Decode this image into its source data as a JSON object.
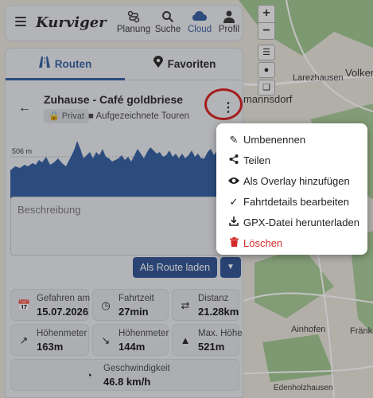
{
  "app": {
    "logo": "Kurviger"
  },
  "nav": {
    "items": [
      {
        "label": "Planung",
        "icon": "route-icon"
      },
      {
        "label": "Suche",
        "icon": "search-icon"
      },
      {
        "label": "Cloud",
        "icon": "cloud-icon",
        "active": true
      },
      {
        "label": "Profil",
        "icon": "person-icon"
      }
    ]
  },
  "tabs": [
    {
      "label": "Routen",
      "icon": "road-icon",
      "active": true
    },
    {
      "label": "Favoriten",
      "icon": "pin-icon"
    }
  ],
  "route": {
    "title": "Zuhause - Café goldbriese",
    "privacy": "Privat",
    "folder": "Aufgezeichnete Touren"
  },
  "chart_data": {
    "type": "area",
    "title": "",
    "ylabel": "",
    "gridline_label": "506 m",
    "note": "elevation profile"
  },
  "description": {
    "placeholder": "Beschreibung"
  },
  "actions": {
    "load_route": "Als Route laden"
  },
  "stats": [
    {
      "label": "Gefahren am",
      "value": "15.07.2026",
      "icon": "calendar-icon"
    },
    {
      "label": "Fahrtzeit",
      "value": "27min",
      "icon": "clock-icon"
    },
    {
      "label": "Distanz",
      "value": "21.28km",
      "icon": "arrows-icon"
    },
    {
      "label": "Höhenmeter",
      "value": "163m",
      "icon": "up-arrow-icon"
    },
    {
      "label": "Höhenmeter",
      "value": "144m",
      "icon": "down-arrow-icon"
    },
    {
      "label": "Max. Höhe",
      "value": "521m",
      "icon": "mountain-icon"
    },
    {
      "label": "Geschwindigkeit",
      "value": "46.8 km/h",
      "icon": "speedometer-icon"
    }
  ],
  "menu": [
    {
      "label": "Umbenennen",
      "icon": "pencil-icon"
    },
    {
      "label": "Teilen",
      "icon": "share-icon"
    },
    {
      "label": "Als Overlay hinzufügen",
      "icon": "eye-icon"
    },
    {
      "label": "Fahrtdetails bearbeiten",
      "icon": "check-icon"
    },
    {
      "label": "GPX-Datei herunterladen",
      "icon": "download-icon"
    },
    {
      "label": "Löschen",
      "icon": "trash-icon",
      "danger": true
    }
  ],
  "map": {
    "places": [
      "Larezhausen",
      "Volker",
      "mannsdorf",
      "Ainhofen",
      "Fränk",
      "Edenholzhausen"
    ],
    "controls": {
      "zoom_in": "+",
      "zoom_out": "−"
    }
  },
  "colors": {
    "accent": "#2f5b9e",
    "danger": "#d42a2a",
    "highlight_ring": "#d51a1a"
  }
}
